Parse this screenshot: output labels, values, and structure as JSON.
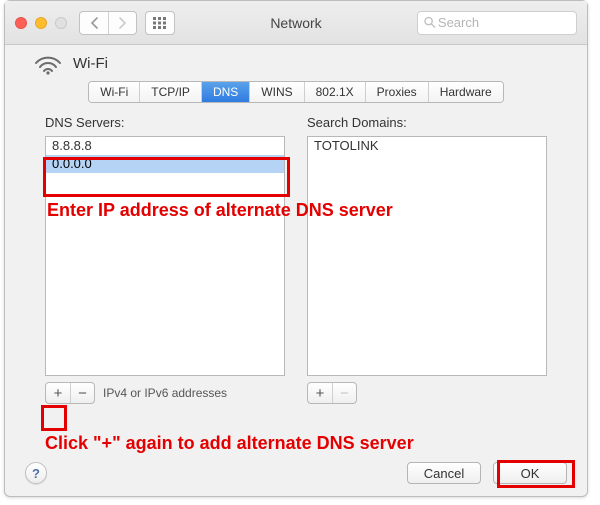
{
  "titlebar": {
    "window_title": "Network",
    "search_placeholder": "Search"
  },
  "header": {
    "connection_name": "Wi-Fi"
  },
  "tabs": [
    {
      "label": "Wi-Fi",
      "selected": false
    },
    {
      "label": "TCP/IP",
      "selected": false
    },
    {
      "label": "DNS",
      "selected": true
    },
    {
      "label": "WINS",
      "selected": false
    },
    {
      "label": "802.1X",
      "selected": false
    },
    {
      "label": "Proxies",
      "selected": false
    },
    {
      "label": "Hardware",
      "selected": false
    }
  ],
  "dns": {
    "title": "DNS Servers:",
    "entries": [
      {
        "value": "8.8.8.8",
        "editing": false
      },
      {
        "value": "0.0.0.0",
        "editing": true
      }
    ],
    "add_hint": "IPv4 or IPv6 addresses",
    "plus": "+",
    "minus": "−"
  },
  "search_domains": {
    "title": "Search Domains:",
    "entries": [
      {
        "value": "TOTOLINK",
        "editing": false
      }
    ],
    "plus": "+",
    "minus": "−"
  },
  "footer": {
    "help": "?",
    "cancel": "Cancel",
    "ok": "OK"
  },
  "annotations": {
    "text1": "Enter IP address of alternate DNS server",
    "text2": "Click \"+\" again to add alternate DNS server"
  }
}
